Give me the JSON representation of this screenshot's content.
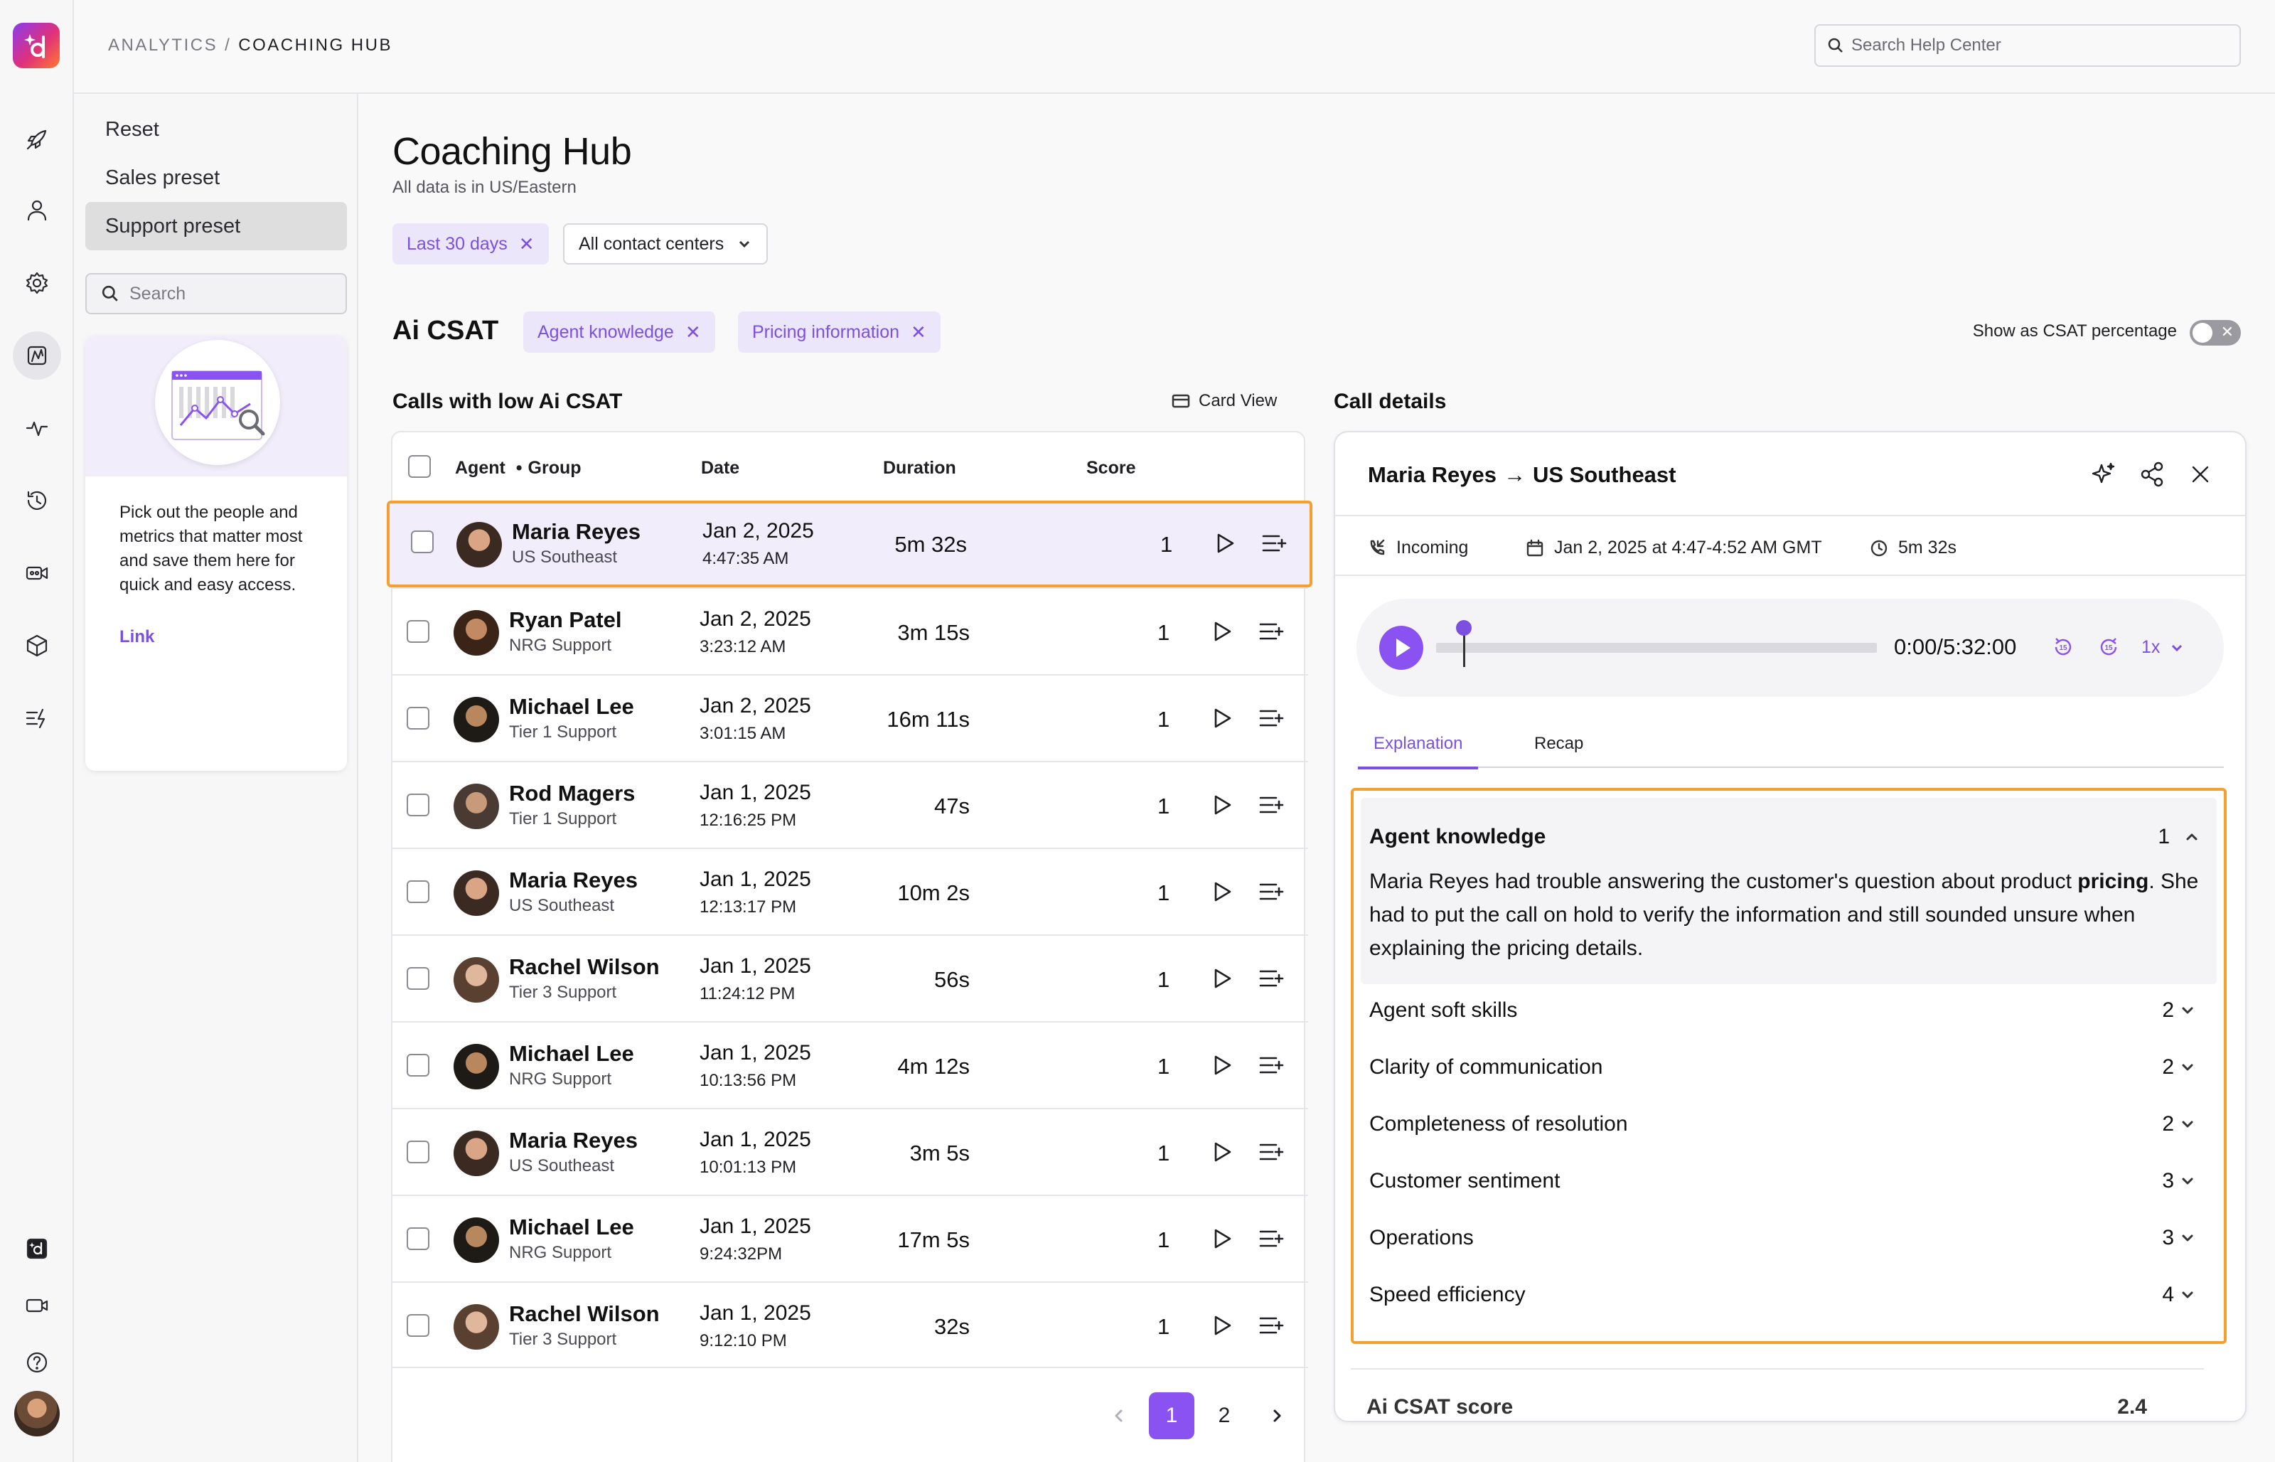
{
  "breadcrumb": {
    "parent": "ANALYTICS",
    "separator": "/",
    "current": "COACHING HUB"
  },
  "help_search": {
    "placeholder": "Search Help Center"
  },
  "presets": {
    "items": [
      {
        "label": "Reset",
        "active": false
      },
      {
        "label": "Sales preset",
        "active": false
      },
      {
        "label": "Support preset",
        "active": true
      }
    ],
    "search_placeholder": "Search",
    "promo_text": "Pick out the people and metrics that matter most and save them here for quick and easy access.",
    "promo_link": "Link"
  },
  "page": {
    "title": "Coaching Hub",
    "subtitle": "All data is in US/Eastern",
    "filters": {
      "date": "Last 30 days",
      "centers": "All contact centers"
    }
  },
  "csat": {
    "title": "Ai CSAT",
    "filters": [
      "Agent knowledge",
      "Pricing information"
    ],
    "toggle_label": "Show as CSAT percentage",
    "toggle_on": false
  },
  "calls": {
    "title": "Calls with low Ai CSAT",
    "card_view": "Card View",
    "headers": {
      "agent": "Agent",
      "dot": "•",
      "group": "Group",
      "date": "Date",
      "duration": "Duration",
      "score": "Score"
    },
    "rows": [
      {
        "name": "Maria Reyes",
        "group": "US Southeast",
        "date": "Jan 2, 2025",
        "time": "4:47:35 AM",
        "duration": "5m 32s",
        "score": "1",
        "selected": true
      },
      {
        "name": "Ryan Patel",
        "group": "NRG Support",
        "date": "Jan 2, 2025",
        "time": "3:23:12 AM",
        "duration": "3m 15s",
        "score": "1"
      },
      {
        "name": "Michael Lee",
        "group": "Tier 1 Support",
        "date": "Jan 2, 2025",
        "time": "3:01:15 AM",
        "duration": "16m 11s",
        "score": "1"
      },
      {
        "name": "Rod Magers",
        "group": "Tier 1 Support",
        "date": "Jan 1, 2025",
        "time": "12:16:25 PM",
        "duration": "47s",
        "score": "1"
      },
      {
        "name": "Maria Reyes",
        "group": "US Southeast",
        "date": "Jan 1, 2025",
        "time": "12:13:17 PM",
        "duration": "10m 2s",
        "score": "1"
      },
      {
        "name": "Rachel Wilson",
        "group": "Tier 3 Support",
        "date": "Jan 1, 2025",
        "time": "11:24:12 PM",
        "duration": "56s",
        "score": "1"
      },
      {
        "name": "Michael Lee",
        "group": "NRG Support",
        "date": "Jan 1, 2025",
        "time": "10:13:56 PM",
        "duration": "4m 12s",
        "score": "1"
      },
      {
        "name": "Maria Reyes",
        "group": "US Southeast",
        "date": "Jan 1, 2025",
        "time": "10:01:13 PM",
        "duration": "3m 5s",
        "score": "1"
      },
      {
        "name": "Michael Lee",
        "group": "NRG Support",
        "date": "Jan 1, 2025",
        "time": "9:24:32PM",
        "duration": "17m 5s",
        "score": "1"
      },
      {
        "name": "Rachel Wilson",
        "group": "Tier 3 Support",
        "date": "Jan 1, 2025",
        "time": "9:12:10 PM",
        "duration": "32s",
        "score": "1"
      }
    ],
    "pagination": {
      "pages": [
        "1",
        "2"
      ],
      "current": "1"
    }
  },
  "details": {
    "title": "Call details",
    "agent": "Maria Reyes",
    "group": "US Southeast",
    "direction": "Incoming",
    "datetime": "Jan 2, 2025 at 4:47-4:52 AM GMT",
    "duration": "5m 32s",
    "player": {
      "time": "0:00/5:32:00",
      "speed": "1x",
      "progress": 0.0,
      "skip_back": "15",
      "skip_fwd": "15"
    },
    "tabs": [
      "Explanation",
      "Recap"
    ],
    "expanded": {
      "name": "Agent knowledge",
      "score": "1",
      "explanation_before": "Maria Reyes had trouble answering the customer's question about product ",
      "explanation_bold": "pricing",
      "explanation_after": ". She had to put the call on hold to verify the information and still sounded unsure when explaining the pricing details."
    },
    "criteria": [
      {
        "name": "Agent soft skills",
        "score": "2"
      },
      {
        "name": "Clarity of communication",
        "score": "2"
      },
      {
        "name": "Completeness of resolution",
        "score": "2"
      },
      {
        "name": "Customer sentiment",
        "score": "3"
      },
      {
        "name": "Operations",
        "score": "3"
      },
      {
        "name": "Speed efficiency",
        "score": "4"
      }
    ],
    "total_label": "Ai CSAT score",
    "total_value": "2.4"
  },
  "colors": {
    "accent": "#8a52f0",
    "accent_text": "#7b4fe0",
    "highlight": "#f5a02e",
    "chip_bg": "#ece6fb"
  }
}
